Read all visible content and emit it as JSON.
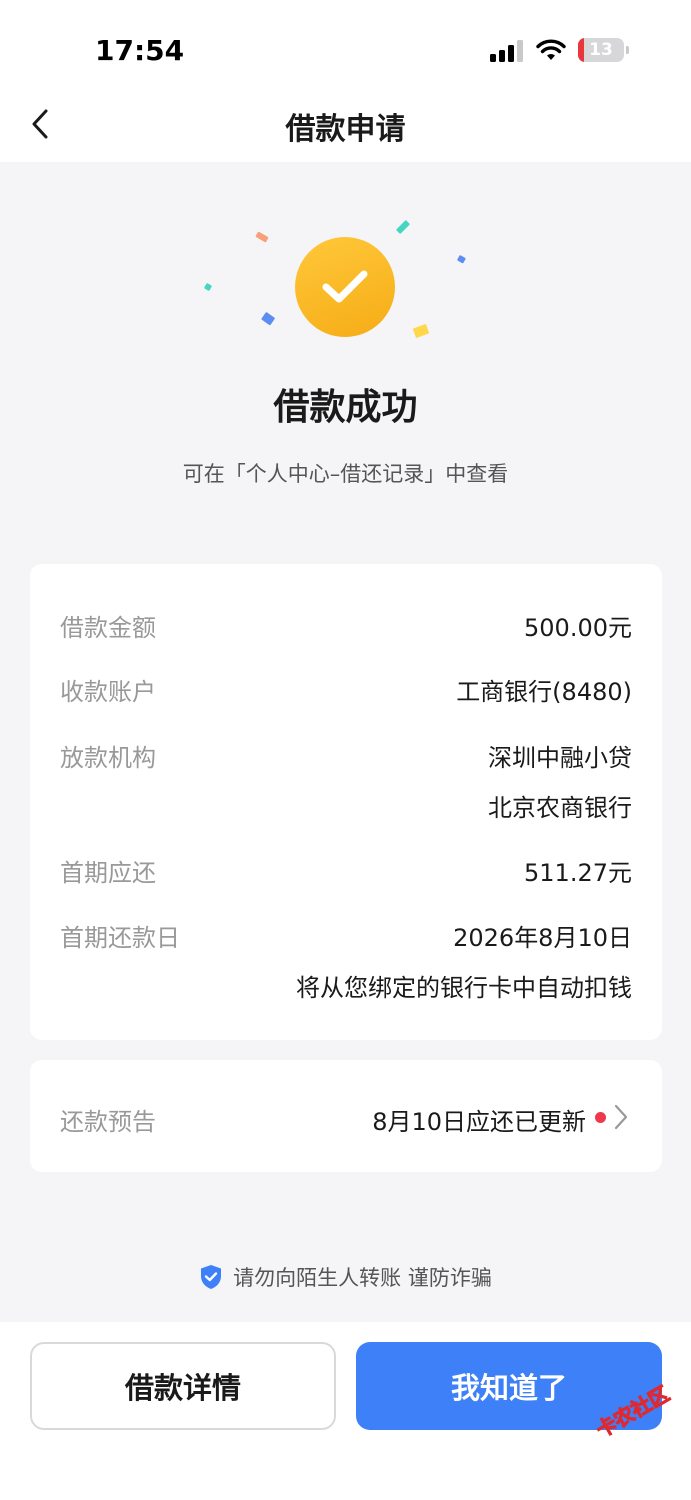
{
  "status_bar": {
    "time": "17:54",
    "battery_level": "13",
    "battery_color": "#e8363a"
  },
  "nav": {
    "back_icon": "chevron-left-icon",
    "title": "借款申请"
  },
  "result": {
    "icon": "check-circle-icon",
    "icon_color": "#f6ac16",
    "title": "借款成功",
    "hint": "可在「个人中心–借还记录」中查看"
  },
  "details": {
    "amount": {
      "label": "借款金额",
      "value": "500.00元"
    },
    "account": {
      "label": "收款账户",
      "value": "工商银行(8480)"
    },
    "lender": {
      "label": "放款机构",
      "value_1": "深圳中融小贷",
      "value_2": "北京农商银行"
    },
    "first_payment": {
      "label": "首期应还",
      "value": "511.27元"
    },
    "first_due_date": {
      "label": "首期还款日",
      "value": "2026年8月10日",
      "note": "将从您绑定的银行卡中自动扣钱"
    }
  },
  "notice": {
    "label": "还款预告",
    "value": "8月10日应还已更新",
    "dot_color": "#f0384b"
  },
  "safety": {
    "icon": "shield-check-icon",
    "text": "请勿向陌生人转账 谨防诈骗"
  },
  "actions": {
    "detail_label": "借款详情",
    "ok_label": "我知道了",
    "accent_color": "#3d80f7"
  },
  "watermark": {
    "text": "卡农社区"
  }
}
